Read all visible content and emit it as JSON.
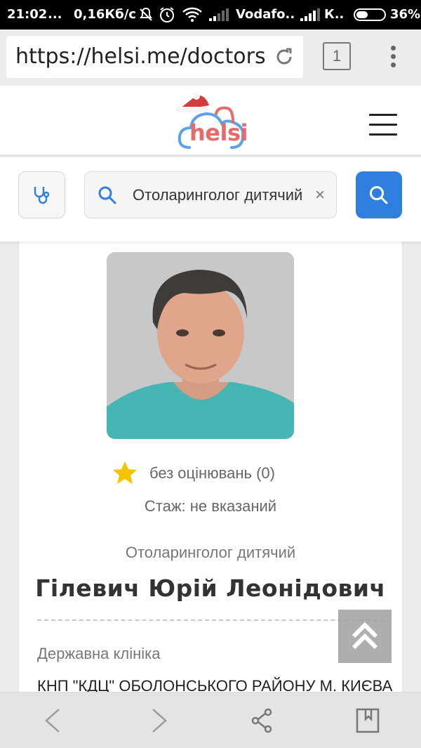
{
  "status_bar": {
    "time": "21:02",
    "dots": "...",
    "speed": "0,16Кб/с",
    "carrier1": "Vodafo..",
    "carrier2": "К..",
    "battery": "36%"
  },
  "browser": {
    "url": "https://helsi.me/doctors",
    "tab_count": "1"
  },
  "header": {
    "logo_text": "helsi"
  },
  "search": {
    "value": "Отоларинголог дитячий",
    "clear": "×"
  },
  "doctor": {
    "rating_text": "без оцінювань (0)",
    "experience": "Стаж: не вказаний",
    "specialty": "Отоларинголог дитячий",
    "name": "Гілевич Юрій Леонідович",
    "clinic_type": "Державна клініка",
    "clinic_name": "КНП \"КДЦ\" ОБОЛОНСЬКОГО РАЙОНУ М. КИЄВА"
  },
  "colors": {
    "brand_red": "#e86a6a",
    "brand_blue": "#5aa3e8",
    "accent_blue": "#2f7fde",
    "star": "#f5c400"
  }
}
